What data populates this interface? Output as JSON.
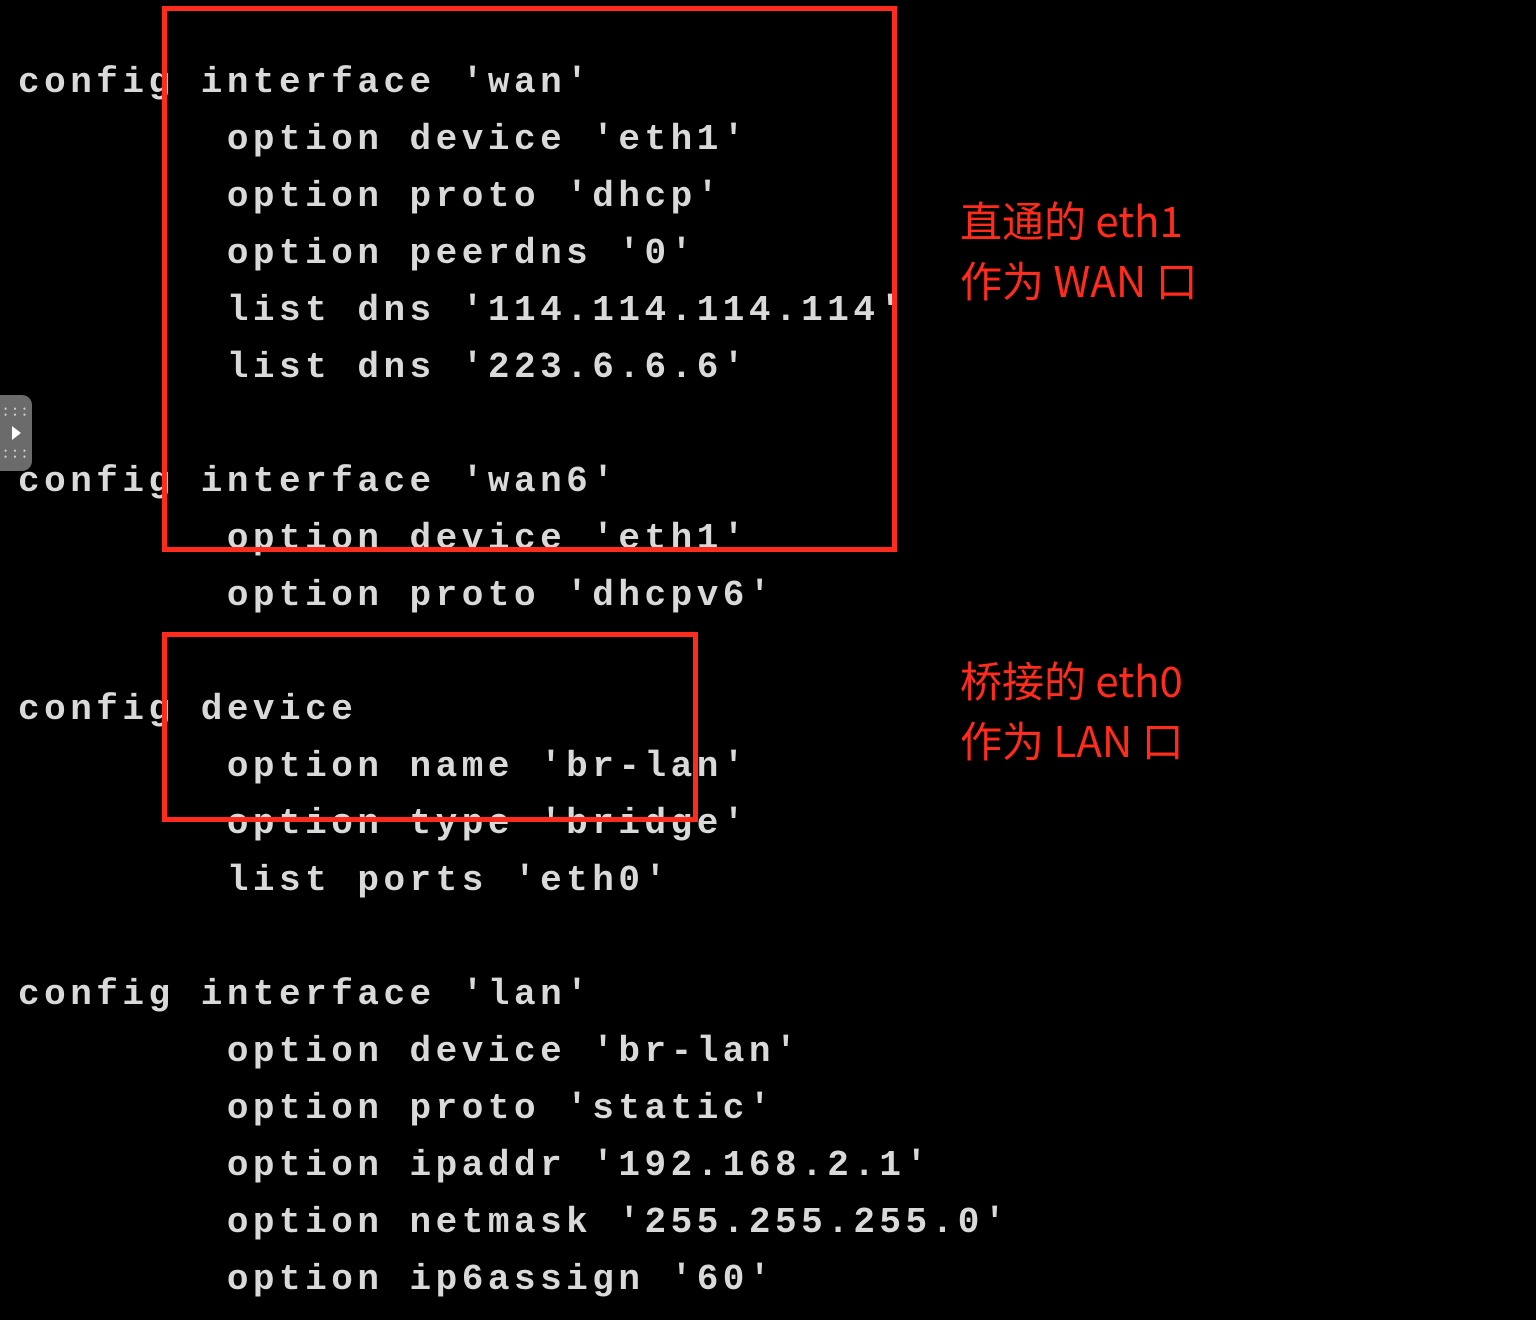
{
  "terminal": {
    "wan_block": "config interface 'wan'\n        option device 'eth1'\n        option proto 'dhcp'\n        option peerdns '0'\n        list dns '114.114.114.114'\n        list dns '223.6.6.6'\n\nconfig interface 'wan6'\n        option device 'eth1'\n        option proto 'dhcpv6'\n",
    "device_block": "config device\n        option name 'br-lan'\n        option type 'bridge'\n        list ports 'eth0'\n",
    "lan_block": "config interface 'lan'\n        option device 'br-lan'\n        option proto 'static'\n        option ipaddr '192.168.2.1'\n        option netmask '255.255.255.0'\n        option ip6assign '60'"
  },
  "annotations": {
    "wan": "直通的 eth1\n作为 WAN 口",
    "lan": "桥接的 eth0\n作为 LAN 口"
  }
}
